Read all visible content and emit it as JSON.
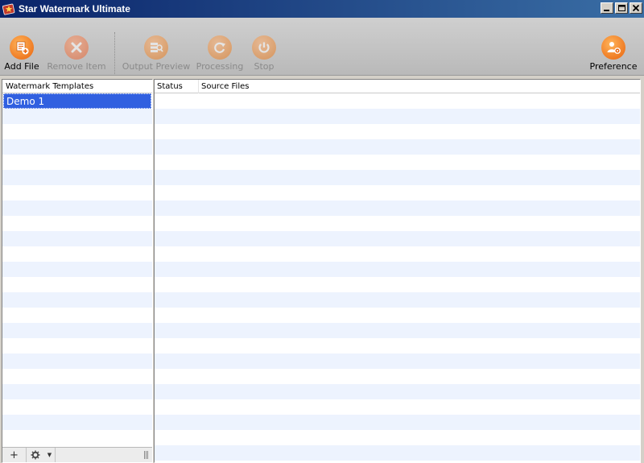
{
  "window": {
    "title": "Star Watermark Ultimate",
    "minimize_label": "_",
    "maximize_label": "□",
    "close_label": "×"
  },
  "toolbar": {
    "add_file": "Add File",
    "remove_item": "Remove Item",
    "output_preview": "Output Preview",
    "processing": "Processing",
    "stop": "Stop",
    "preference": "Preference"
  },
  "templates_panel": {
    "header": "Watermark Templates",
    "items": [
      "Demo 1"
    ],
    "footer": {
      "add_label": "+",
      "menu_caret": "▼"
    }
  },
  "files_panel": {
    "columns": [
      "Status",
      "Source Files"
    ]
  },
  "colors": {
    "accent_orange": "#f07d1f",
    "selection_blue": "#3160e0",
    "row_alt": "#edf3fe",
    "title_bar": "#0a246a"
  }
}
